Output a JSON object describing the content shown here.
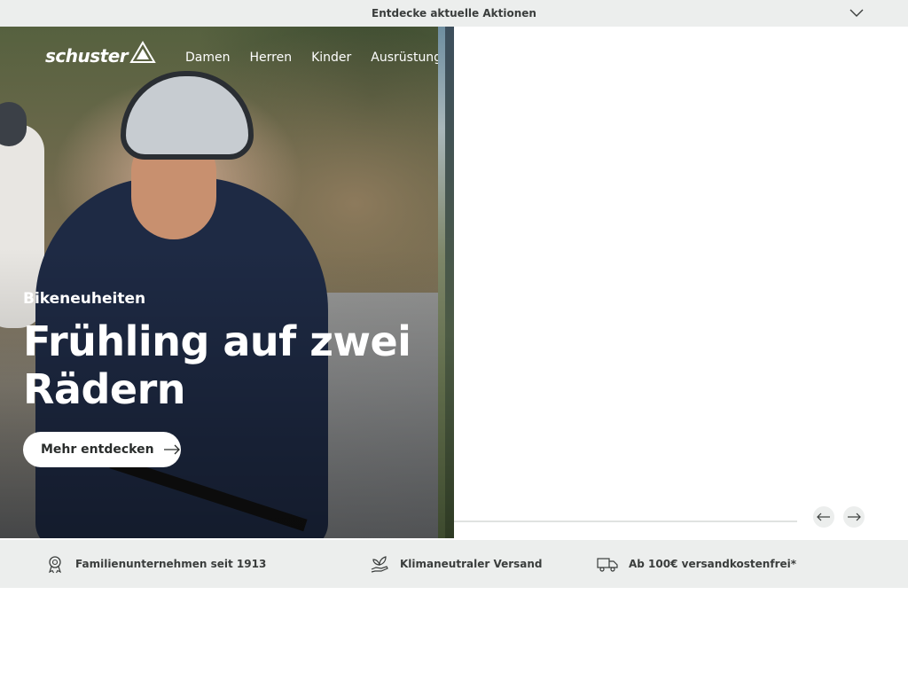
{
  "promo": {
    "text": "Entdecke aktuelle Aktionen",
    "chevron_icon": "chevron-down-icon"
  },
  "header": {
    "logo_text": "schuster",
    "nav": [
      {
        "label": "Damen"
      },
      {
        "label": "Herren"
      },
      {
        "label": "Kinder"
      },
      {
        "label": "Ausrüstung"
      }
    ]
  },
  "hero": {
    "eyebrow": "Bikeneuheiten",
    "title": "Frühling auf zwei Rädern",
    "cta_label": "Mehr entdecken",
    "cta_icon": "arrow-right-icon"
  },
  "slider": {
    "progress": 0.0,
    "prev_icon": "arrow-left-icon",
    "next_icon": "arrow-right-icon"
  },
  "usps": [
    {
      "icon": "award-icon",
      "text": "Familienunternehmen seit 1913"
    },
    {
      "icon": "leaf-hand-icon",
      "text": "Klimaneutraler Versand"
    },
    {
      "icon": "truck-icon",
      "text": "Ab 100€ versandkostenfrei*"
    }
  ],
  "colors": {
    "bar_background": "#eceeed",
    "text_dark": "#3a3d3c",
    "hero_text": "#ffffff"
  }
}
